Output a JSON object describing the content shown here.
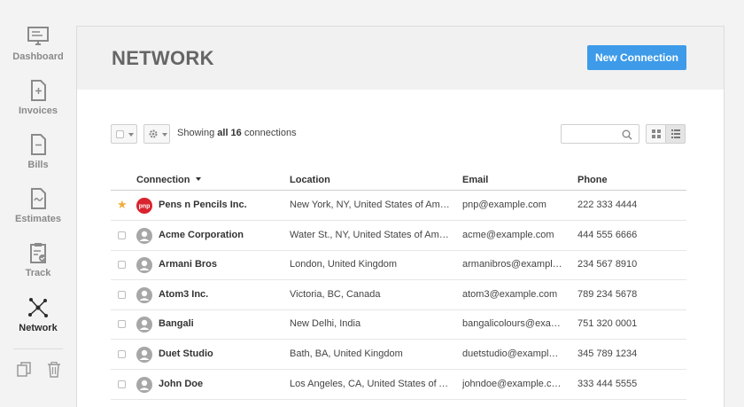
{
  "nav": {
    "items": [
      {
        "label": "Dashboard",
        "icon": "monitor-icon"
      },
      {
        "label": "Invoices",
        "icon": "invoice-icon"
      },
      {
        "label": "Bills",
        "icon": "bill-icon"
      },
      {
        "label": "Estimates",
        "icon": "estimate-icon"
      },
      {
        "label": "Track",
        "icon": "clipboard-check-icon"
      },
      {
        "label": "Network",
        "icon": "network-icon"
      }
    ],
    "tools": [
      "copy-icon",
      "trash-icon"
    ]
  },
  "header": {
    "title": "NETWORK",
    "new_button": "New Connection"
  },
  "toolbar": {
    "showing_prefix": "Showing",
    "showing_all": "all 16",
    "showing_suffix": "connections",
    "search_placeholder": ""
  },
  "table": {
    "columns": [
      "Connection",
      "Location",
      "Email",
      "Phone"
    ],
    "rows": [
      {
        "name": "Pens n Pencils Inc.",
        "location": "New York, NY, United States of America",
        "email": "pnp@example.com",
        "phone": "222 333 4444",
        "starred": true,
        "avatar_text": "pnp"
      },
      {
        "name": "Acme Corporation",
        "location": "Water St., NY, United States of America",
        "email": "acme@example.com",
        "phone": "444 555 6666",
        "starred": false
      },
      {
        "name": "Armani Bros",
        "location": "London, United Kingdom",
        "email": "armanibros@example.com",
        "phone": "234 567 8910",
        "starred": false
      },
      {
        "name": "Atom3 Inc.",
        "location": "Victoria, BC, Canada",
        "email": "atom3@example.com",
        "phone": "789 234 5678",
        "starred": false
      },
      {
        "name": "Bangali",
        "location": "New Delhi, India",
        "email": "bangalicolours@example.com",
        "phone": "751 320 0001",
        "starred": false
      },
      {
        "name": "Duet Studio",
        "location": "Bath, BA, United Kingdom",
        "email": "duetstudio@example.com",
        "phone": "345 789 1234",
        "starred": false
      },
      {
        "name": "John Doe",
        "location": "Los Angeles, CA, United States of America",
        "email": "johndoe@example.com",
        "phone": "333 444 5555",
        "starred": false
      }
    ]
  },
  "colors": {
    "accent": "#3d9be9",
    "star": "#f0ad3a",
    "pnp_logo": "#d9232e"
  }
}
